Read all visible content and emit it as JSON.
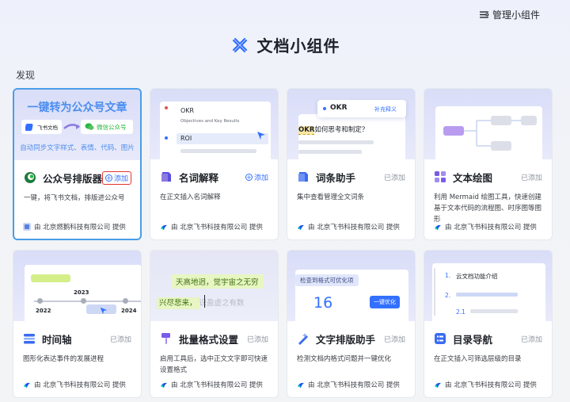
{
  "manage": {
    "label": "管理小组件",
    "icon": "settings-icon"
  },
  "header": {
    "title": "文档小组件",
    "icon": "widget-logo-icon"
  },
  "section": {
    "label": "发现"
  },
  "cards": [
    {
      "id": "wechat",
      "title": "公众号排版器",
      "status": "添加",
      "desc": "一键，将飞书文档，排版进公众号",
      "provider": "由 北京燃鹅科技有限公司 提供",
      "preview": {
        "headline": "一键转为公众号文章",
        "left_pill": "飞书文档",
        "right_pill": "微信公众号",
        "sub": "自动同步文字样式、表情、代码、图片"
      }
    },
    {
      "id": "glossary",
      "title": "名词解释",
      "status": "添加",
      "desc": "在正文插入名词解释",
      "provider": "由 北京飞书科技有限公司 提供",
      "preview": {
        "item1": "OKR",
        "item1_sub": "Objectives and Key Results",
        "item2": "ROI"
      }
    },
    {
      "id": "term",
      "title": "词条助手",
      "status": "已添加",
      "desc": "集中查看管理全文词条",
      "provider": "由 北京飞书科技有限公司 提供",
      "preview": {
        "tag": "OKR",
        "tag_action": "补充释义",
        "question_highlight": "OKR",
        "question_rest": "如何思考和制定？"
      }
    },
    {
      "id": "diagram",
      "title": "文本绘图",
      "status": "已添加",
      "desc": "利用 Mermaid 绘图工具，快速创建基于文本代码的流程图、时序图等图形",
      "provider": "由 北京飞书科技有限公司 提供"
    },
    {
      "id": "timeline",
      "title": "时间轴",
      "status": "已添加",
      "desc": "图形化表达事件的发展进程",
      "provider": "由 北京飞书科技有限公司 提供",
      "preview": {
        "years": [
          "2022",
          "2023",
          "2024"
        ]
      }
    },
    {
      "id": "batch",
      "title": "批量格式设置",
      "status": "已添加",
      "desc": "启用工具后，选中正文文字即可快速设置格式",
      "provider": "由 北京飞书科技有限公司 提供",
      "preview": {
        "line1": "天高地迥，觉宇宙之无穷",
        "line2a": "兴尽悲来，",
        "line2b": "识盈虚之有数"
      }
    },
    {
      "id": "typeset",
      "title": "文字排版助手",
      "status": "已添加",
      "desc": "检测文档内格式问题并一键优化",
      "provider": "由 北京飞书科技有限公司 提供",
      "preview": {
        "label": "检查到格式可优化项",
        "count": "16",
        "action": "一键优化"
      }
    },
    {
      "id": "toc",
      "title": "目录导航",
      "status": "已添加",
      "desc": "在正文插入可筛选层级的目录",
      "provider": "由 北京飞书科技有限公司 提供",
      "preview": {
        "h1_num": "1.",
        "h1": "云文档功能介绍",
        "h2_num": "2.",
        "h3_num": "2.1"
      }
    }
  ],
  "colors": {
    "accent": "#3370ff",
    "selected_border": "#4b9de8",
    "add_highlight": "#e2362f"
  }
}
